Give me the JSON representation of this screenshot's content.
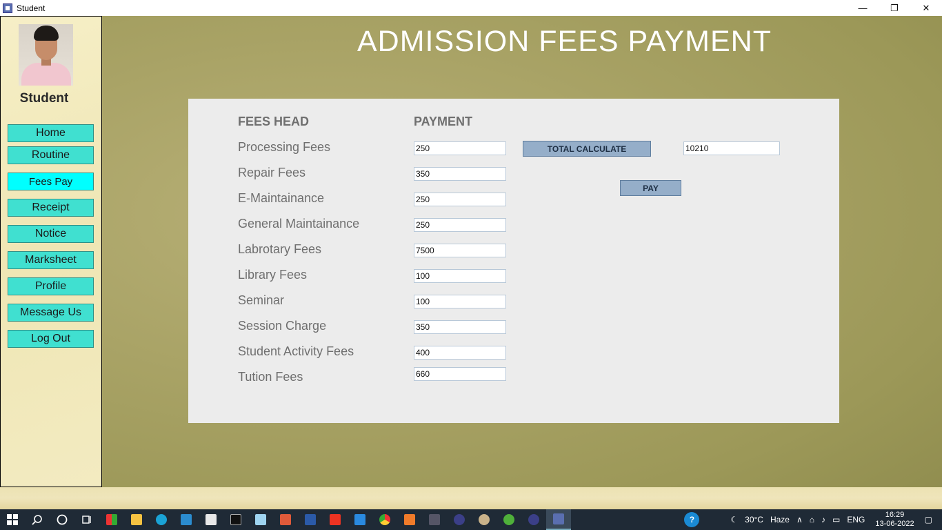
{
  "window": {
    "title": "Student",
    "minimize": "—",
    "restore": "❐",
    "close": "✕"
  },
  "sidebar": {
    "user_label": "Student",
    "items": [
      {
        "label": "Home"
      },
      {
        "label": "Routine"
      },
      {
        "label": "Fees Pay"
      },
      {
        "label": "Receipt"
      },
      {
        "label": "Notice"
      },
      {
        "label": "Marksheet"
      },
      {
        "label": "Profile"
      },
      {
        "label": "Message Us"
      },
      {
        "label": "Log Out"
      }
    ],
    "active_item": "Fees Pay",
    "button_color": "#40e0d0",
    "active_color": "#00ffff"
  },
  "page": {
    "heading": "ADMISSION FEES PAYMENT"
  },
  "fees": {
    "col_head": "FEES HEAD",
    "col_payment": "PAYMENT",
    "rows": [
      {
        "label": "Processing Fees",
        "value": "250"
      },
      {
        "label": "Repair Fees",
        "value": "350"
      },
      {
        "label": "E-Maintainance",
        "value": "250"
      },
      {
        "label": "General Maintainance",
        "value": "250"
      },
      {
        "label": "Labrotary Fees",
        "value": "7500"
      },
      {
        "label": "Library Fees",
        "value": "100"
      },
      {
        "label": "Seminar",
        "value": "100"
      },
      {
        "label": "Session Charge",
        "value": "350"
      },
      {
        "label": "Student Activity Fees",
        "value": "400"
      },
      {
        "label": "Tution Fees",
        "value": "660"
      }
    ],
    "total_button": "TOTAL CALCULATE",
    "total_value": "10210",
    "pay_button": "PAY"
  },
  "taskbar": {
    "weather_temp": "30°C",
    "weather_desc": "Haze",
    "language": "ENG",
    "time": "16:29",
    "date": "13-06-2022"
  }
}
